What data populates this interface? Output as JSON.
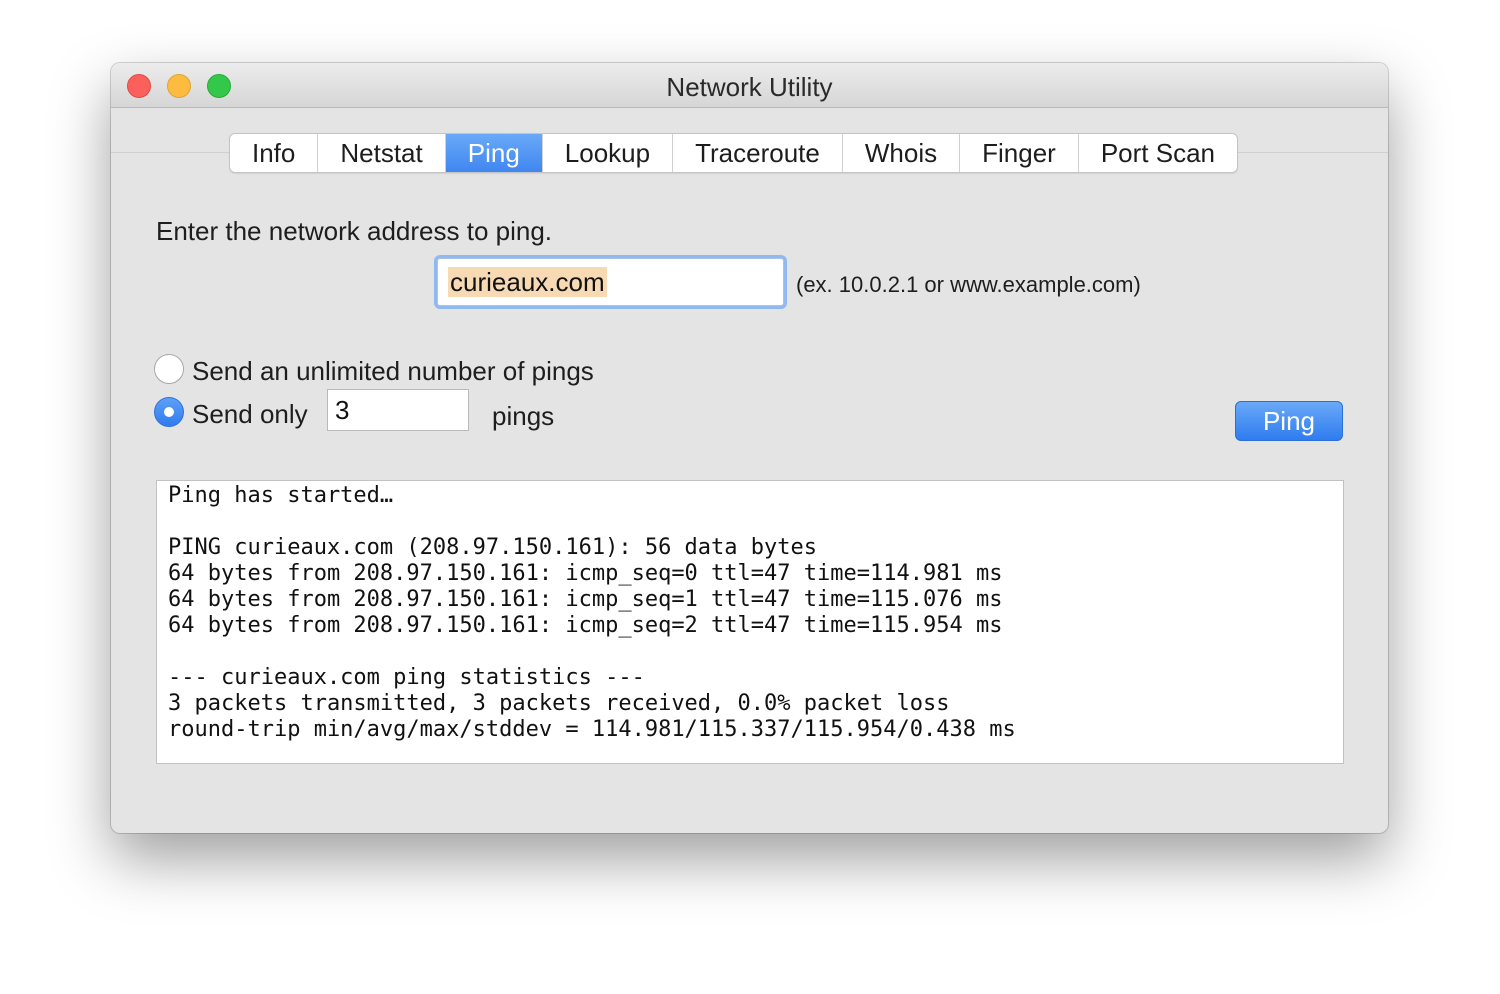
{
  "window": {
    "title": "Network Utility"
  },
  "tabs": [
    {
      "label": "Info",
      "active": false
    },
    {
      "label": "Netstat",
      "active": false
    },
    {
      "label": "Ping",
      "active": true
    },
    {
      "label": "Lookup",
      "active": false
    },
    {
      "label": "Traceroute",
      "active": false
    },
    {
      "label": "Whois",
      "active": false
    },
    {
      "label": "Finger",
      "active": false
    },
    {
      "label": "Port Scan",
      "active": false
    }
  ],
  "ping": {
    "prompt": "Enter the network address to ping.",
    "address_value": "curieaux.com",
    "address_hint": "(ex. 10.0.2.1 or www.example.com)",
    "unlimited_label": "Send an unlimited number of pings",
    "unlimited_selected": false,
    "send_only_label": "Send only",
    "send_only_selected": true,
    "count_value": "3",
    "pings_suffix": "pings",
    "button_label": "Ping"
  },
  "output": {
    "lines": [
      "Ping has started…",
      "",
      "PING curieaux.com (208.97.150.161): 56 data bytes",
      "64 bytes from 208.97.150.161: icmp_seq=0 ttl=47 time=114.981 ms",
      "64 bytes from 208.97.150.161: icmp_seq=1 ttl=47 time=115.076 ms",
      "64 bytes from 208.97.150.161: icmp_seq=2 ttl=47 time=115.954 ms",
      "",
      "--- curieaux.com ping statistics ---",
      "3 packets transmitted, 3 packets received, 0.0% packet loss",
      "round-trip min/avg/max/stddev = 114.981/115.337/115.954/0.438 ms"
    ]
  },
  "colors": {
    "accent": "#3f86f0",
    "close": "#fc605c",
    "minimize": "#fdbc40",
    "zoom": "#34c84a",
    "selection": "#f7d9b4"
  }
}
